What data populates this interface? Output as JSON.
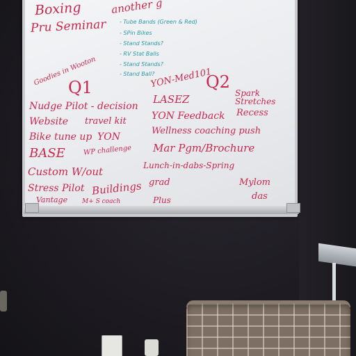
{
  "scene": "office wall with whiteboard",
  "whiteboard": {
    "top_left": [
      "Boxing",
      "Pru Seminar"
    ],
    "top_right_fragment": "another g",
    "teal_list": [
      "- Tube Bands (Green & Red)",
      "- SPin Bikes",
      "- Stand Stands?",
      "- RV Stat Balls",
      "- Stand Stands?",
      "- Stand Ball?"
    ],
    "side_note": "Goodies in Wooton",
    "q1": {
      "heading": "Q1",
      "items": [
        "Nudge Pilot - decision",
        "Website",
        "travel kit",
        "Bike tune up",
        "YON",
        "BASE",
        "WP challenge",
        "Custom W/out",
        "Stress Pilot",
        "Buildings",
        "Vantage",
        "M+ S coach"
      ]
    },
    "q2": {
      "heading": "Q2",
      "top": "YON-Med101",
      "items": [
        "LASEZ",
        "Spark Stretches",
        "YON Feedback",
        "Recess",
        "Wellness coaching push",
        "Mar Pgm/Brochure",
        "Lunch-in-dabs-Spring",
        "grad",
        "Mylom",
        "das",
        "Plus"
      ]
    }
  },
  "colors": {
    "ink_red": "#c8284e",
    "ink_teal": "#2f9aa6",
    "board": "#eef0f2",
    "wall": "#1e1c22"
  }
}
